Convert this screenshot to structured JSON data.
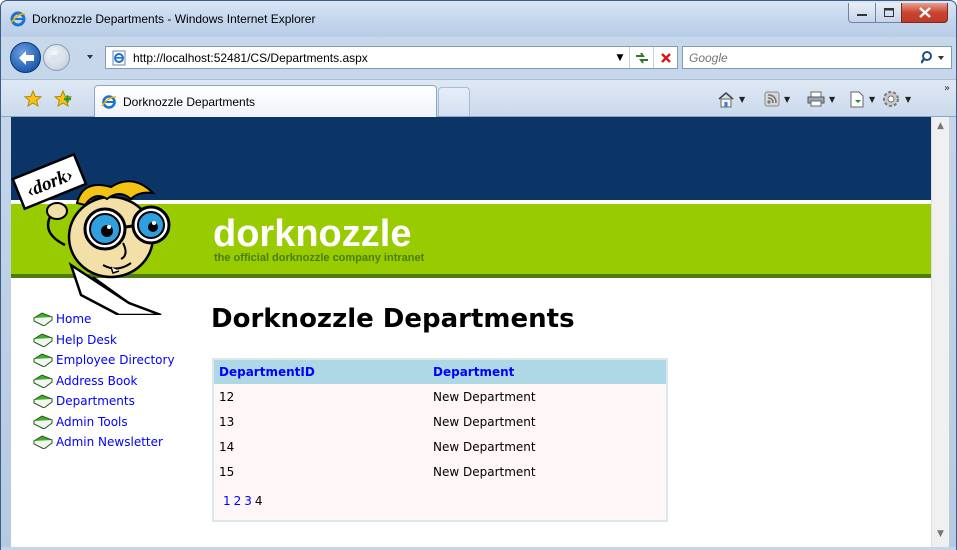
{
  "window": {
    "title": "Dorknozzle Departments - Windows Internet Explorer"
  },
  "address_bar": {
    "url": "http://localhost:52481/CS/Departments.aspx"
  },
  "search": {
    "placeholder": "Google"
  },
  "tab": {
    "label": "Dorknozzle Departments"
  },
  "site": {
    "brand": "dorknozzle",
    "tagline": "the official dorknozzle company intranet",
    "mascot_sign": "‹dork›"
  },
  "menu": [
    {
      "label": "Home"
    },
    {
      "label": "Help Desk"
    },
    {
      "label": "Employee Directory"
    },
    {
      "label": "Address Book"
    },
    {
      "label": "Departments"
    },
    {
      "label": "Admin Tools"
    },
    {
      "label": "Admin Newsletter"
    }
  ],
  "page": {
    "title": "Dorknozzle Departments"
  },
  "grid": {
    "columns": [
      "DepartmentID",
      "Department"
    ],
    "rows": [
      [
        "12",
        "New Department"
      ],
      [
        "13",
        "New Department"
      ],
      [
        "14",
        "New Department"
      ],
      [
        "15",
        "New Department"
      ]
    ],
    "pager": [
      "1",
      "2",
      "3",
      "4"
    ],
    "current_page": "4"
  },
  "colors": {
    "header_navy": "#0b3467",
    "header_green": "#99cc00",
    "grid_header": "#add8e6",
    "link": "#0000ff"
  }
}
